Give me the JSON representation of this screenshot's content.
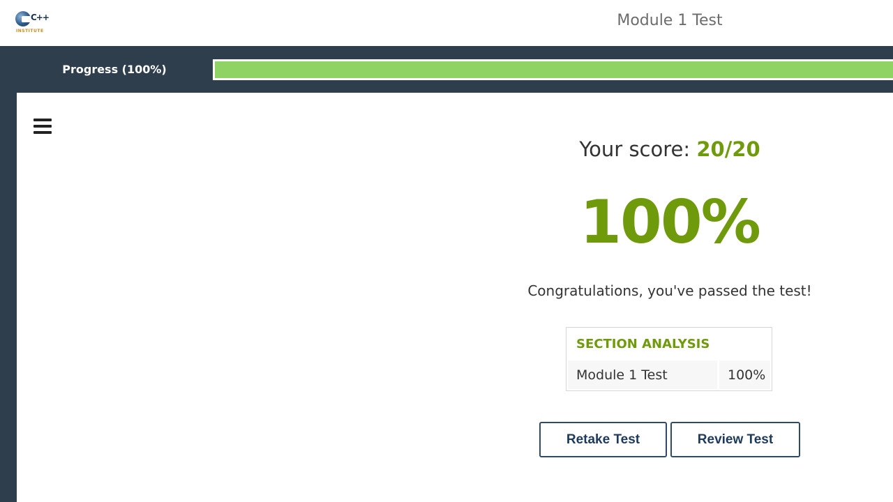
{
  "header": {
    "logo_symbol": "C++",
    "logo_text": "INSTITUTE",
    "title": "Module 1 Test"
  },
  "progress": {
    "label": "Progress (100%)",
    "percent": 100,
    "fill_color": "#8ed363"
  },
  "sidebar": {
    "menu_icon": "hamburger-menu-icon"
  },
  "result": {
    "score_prefix": "Your score:",
    "score_value": "20/20",
    "percent": "100%",
    "message": "Congratulations, you've passed the test!",
    "accent_color": "#6f9a0b"
  },
  "section_analysis": {
    "header": "SECTION ANALYSIS",
    "rows": [
      {
        "name": "Module 1 Test",
        "score": "100%"
      }
    ]
  },
  "actions": {
    "retake_label": "Retake Test",
    "review_label": "Review Test"
  },
  "colors": {
    "dark_band": "#2f3e4d",
    "button_border": "#2f4a66"
  }
}
